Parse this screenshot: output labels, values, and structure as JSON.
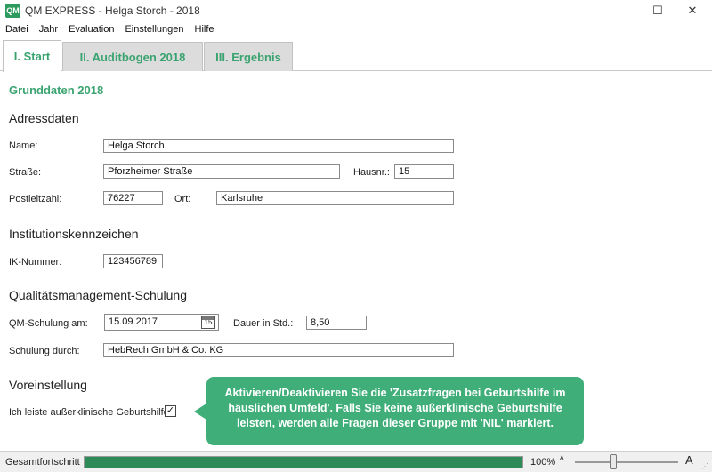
{
  "window": {
    "logo": "QM",
    "title": "QM EXPRESS - Helga Storch - 2018",
    "minimize_icon": "—",
    "maximize_icon": "☐",
    "close_icon": "✕"
  },
  "menu": [
    "Datei",
    "Jahr",
    "Evaluation",
    "Einstellungen",
    "Hilfe"
  ],
  "tabs": [
    {
      "label": "I. Start",
      "active": true
    },
    {
      "label": "II. Auditbogen 2018",
      "active": false
    },
    {
      "label": "III. Ergebnis",
      "active": false
    }
  ],
  "page": {
    "heading": "Grunddaten 2018",
    "address": {
      "title": "Adressdaten",
      "name_label": "Name:",
      "name_value": "Helga Storch",
      "street_label": "Straße:",
      "street_value": "Pforzheimer Straße",
      "houseno_label": "Hausnr.:",
      "houseno_value": "15",
      "zip_label": "Postleitzahl:",
      "zip_value": "76227",
      "city_label": "Ort:",
      "city_value": "Karlsruhe"
    },
    "institution": {
      "title": "Institutionskennzeichen",
      "ik_label": "IK-Nummer:",
      "ik_value": "123456789"
    },
    "qm": {
      "title": "Qualitätsmanagement-Schulung",
      "date_label": "QM-Schulung am:",
      "date_value": "15.09.2017",
      "calendar_day": "15",
      "duration_label": "Dauer in Std.:",
      "duration_value": "8,50",
      "by_label": "Schulung durch:",
      "by_value": "HebRech GmbH & Co. KG"
    },
    "preset": {
      "title": "Voreinstellung",
      "checkbox_label": "Ich leiste außerklinische Geburtshilfe",
      "checkbox_mark": "✓",
      "checked": true
    }
  },
  "tooltip": {
    "text": "Aktivieren/Deaktivieren Sie die 'Zusatzfragen bei Geburtshilfe im häuslichen Umfeld'. Falls Sie keine außerklinische Geburtshilfe leisten, werden alle Fragen dieser Gruppe mit 'NIL' markiert."
  },
  "status": {
    "progress_label": "Gesamtfortschritt",
    "progress_fraction": 1.0,
    "zoom_text": "100%",
    "zoom_small_icon": "ᴬ",
    "zoom_large_icon": "A",
    "zoom_fraction": 0.37
  },
  "colors": {
    "accent": "#3aa370",
    "tooltip_bg": "#3fae79",
    "progress_fill": "#2e8b57"
  }
}
